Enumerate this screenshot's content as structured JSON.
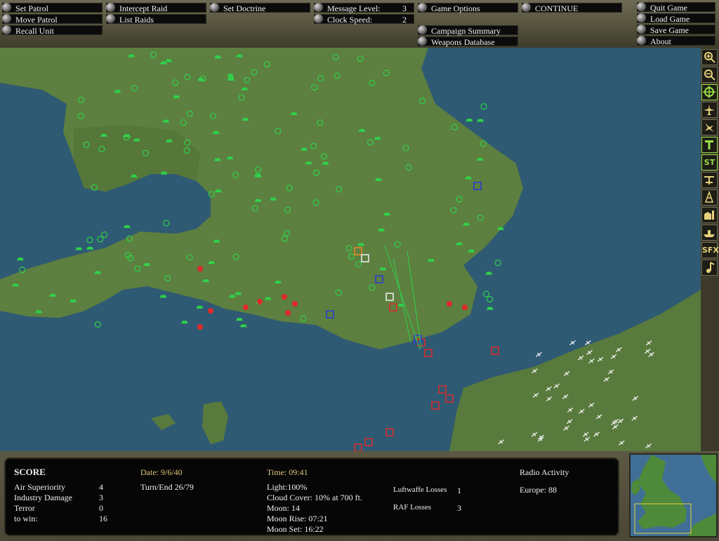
{
  "menu": {
    "set_patrol": "Set Patrol",
    "move_patrol": "Move Patrol",
    "recall_unit": "Recall Unit",
    "intercept_raid": "Intercept Raid",
    "list_raids": "List Raids",
    "set_doctrine": "Set Doctrine",
    "message_level_label": "Message Level:",
    "message_level_value": "3",
    "clock_speed_label": "Clock Speed:",
    "clock_speed_value": "2",
    "game_options": "Game Options",
    "campaign_summary": "Campaign Summary",
    "weapons_database": "Weapons Database",
    "continue": "CONTINUE",
    "quit_game": "Quit Game",
    "load_game": "Load Game",
    "save_game": "Save Game",
    "about": "About"
  },
  "toolbar": {
    "st_label": "ST",
    "sfx_label": "SFX"
  },
  "score": {
    "heading": "SCORE",
    "rows": [
      {
        "label": "Air Superiority",
        "value": "4"
      },
      {
        "label": "Industry Damage",
        "value": "3"
      },
      {
        "label": "Terror",
        "value": "0"
      },
      {
        "label": "to win:",
        "value": "16"
      }
    ],
    "date": "Date: 9/6/40",
    "turn": "Turn/End 26/79",
    "time": "Time: 09:41",
    "light": "Light:100%",
    "cloud_cover": "Cloud Cover: 10% at 700 ft.",
    "moon": "Moon: 14",
    "moon_rise": "Moon Rise: 07:21",
    "moon_set": "Moon Set: 16:22",
    "luftwaffe_losses_label": "Luftwaffe Losses",
    "luftwaffe_losses_value": "1",
    "raf_losses_label": "RAF Losses",
    "raf_losses_value": "3",
    "radio_activity": "Radio Activity",
    "europe": "Europe: 88"
  },
  "colors": {
    "raf_unit": "#2fd24a",
    "raid_red": "#e02a2a",
    "raid_blue": "#2a3ad8",
    "raid_orange": "#f08a1e",
    "luftwaffe_white": "#f2f2f2",
    "sea": "#2f5a73",
    "land": "#5d7f40"
  }
}
